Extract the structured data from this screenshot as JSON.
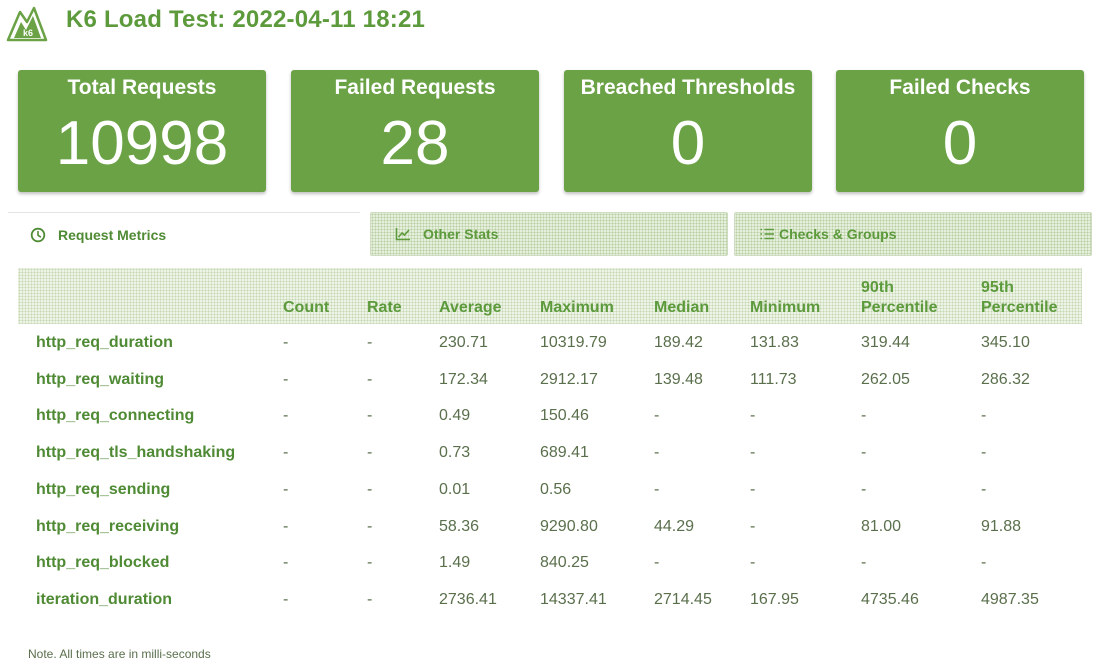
{
  "header": {
    "title": "K6 Load Test: 2022-04-11 18:21"
  },
  "cards": [
    {
      "label": "Total Requests",
      "value": "10998"
    },
    {
      "label": "Failed Requests",
      "value": "28"
    },
    {
      "label": "Breached Thresholds",
      "value": "0"
    },
    {
      "label": "Failed Checks",
      "value": "0"
    }
  ],
  "tabs": [
    {
      "label": "Request Metrics",
      "icon": "clock-icon",
      "active": true
    },
    {
      "label": "Other Stats",
      "icon": "line-chart-icon",
      "active": false
    },
    {
      "label": "Checks & Groups",
      "icon": "list-icon",
      "active": false
    }
  ],
  "table": {
    "columns": [
      "",
      "Count",
      "Rate",
      "Average",
      "Maximum",
      "Median",
      "Minimum",
      "90th Percentile",
      "95th Percentile"
    ],
    "rows": [
      {
        "metric": "http_req_duration",
        "count": "-",
        "rate": "-",
        "avg": "230.71",
        "max": "10319.79",
        "med": "189.42",
        "min": "131.83",
        "p90": "319.44",
        "p95": "345.10"
      },
      {
        "metric": "http_req_waiting",
        "count": "-",
        "rate": "-",
        "avg": "172.34",
        "max": "2912.17",
        "med": "139.48",
        "min": "111.73",
        "p90": "262.05",
        "p95": "286.32"
      },
      {
        "metric": "http_req_connecting",
        "count": "-",
        "rate": "-",
        "avg": "0.49",
        "max": "150.46",
        "med": "-",
        "min": "-",
        "p90": "-",
        "p95": "-"
      },
      {
        "metric": "http_req_tls_handshaking",
        "count": "-",
        "rate": "-",
        "avg": "0.73",
        "max": "689.41",
        "med": "-",
        "min": "-",
        "p90": "-",
        "p95": "-"
      },
      {
        "metric": "http_req_sending",
        "count": "-",
        "rate": "-",
        "avg": "0.01",
        "max": "0.56",
        "med": "-",
        "min": "-",
        "p90": "-",
        "p95": "-"
      },
      {
        "metric": "http_req_receiving",
        "count": "-",
        "rate": "-",
        "avg": "58.36",
        "max": "9290.80",
        "med": "44.29",
        "min": "-",
        "p90": "81.00",
        "p95": "91.88"
      },
      {
        "metric": "http_req_blocked",
        "count": "-",
        "rate": "-",
        "avg": "1.49",
        "max": "840.25",
        "med": "-",
        "min": "-",
        "p90": "-",
        "p95": "-"
      },
      {
        "metric": "iteration_duration",
        "count": "-",
        "rate": "-",
        "avg": "2736.41",
        "max": "14337.41",
        "med": "2714.45",
        "min": "167.95",
        "p90": "4735.46",
        "p95": "4987.35"
      }
    ]
  },
  "footer": {
    "note": "Note. All times are in milli-seconds"
  },
  "colors": {
    "accent": "#6aa245",
    "title": "#5c9a3c"
  }
}
